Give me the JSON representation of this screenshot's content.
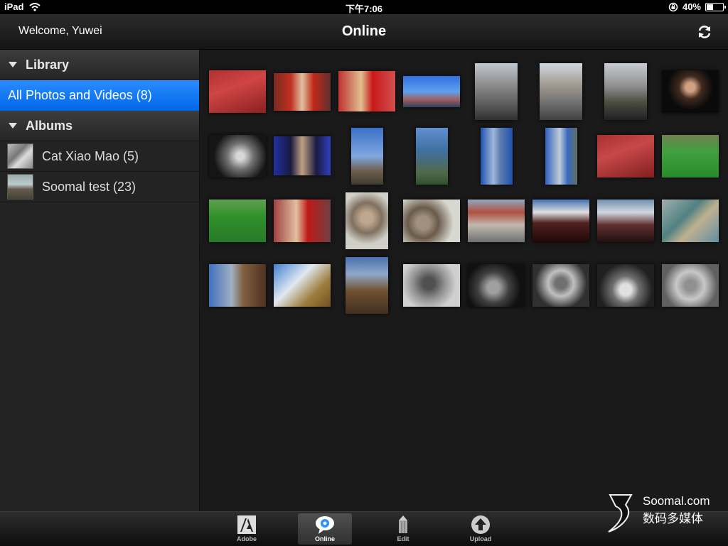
{
  "status_bar": {
    "device": "iPad",
    "time": "下午7:06",
    "battery": "40%",
    "battery_level": 0.4
  },
  "header": {
    "welcome": "Welcome, Yuwei",
    "title": "Online"
  },
  "sidebar": {
    "library_label": "Library",
    "all_photos_label": "All Photos and Videos (8)",
    "albums_label": "Albums",
    "albums": [
      {
        "label": "Cat Xiao Mao (5)"
      },
      {
        "label": "Soomal test (23)"
      }
    ]
  },
  "tabbar": {
    "tabs": [
      {
        "label": "Adobe"
      },
      {
        "label": "Online"
      },
      {
        "label": "Edit"
      },
      {
        "label": "Upload"
      }
    ]
  },
  "watermark": {
    "line1": "Soomal.com",
    "line2": "数码多媒体"
  },
  "colors": {
    "selection": "#0a74f5",
    "background": "#1a1a1a"
  },
  "icons": [
    "wifi-icon",
    "lock-rotation-icon",
    "battery-icon",
    "refresh-icon",
    "adobe-icon",
    "online-icon",
    "edit-icon",
    "upload-icon"
  ]
}
